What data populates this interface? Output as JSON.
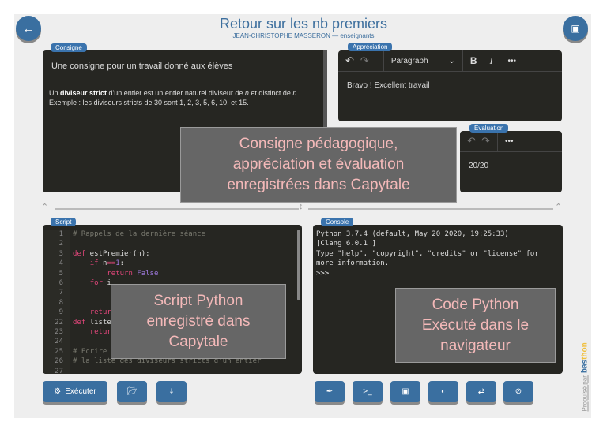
{
  "header": {
    "title": "Retour sur les nb premiers",
    "subtitle": "JEAN-CHRISTOPHE MASSERON — enseignants",
    "back_icon": "arrow-left-icon",
    "save_icon": "floppy-disk-icon"
  },
  "consigne": {
    "tag": "Consigne",
    "heading": "Une consigne pour un travail donné aux élèves",
    "p1_a": "Un ",
    "p1_bold": "diviseur strict",
    "p1_b": " d'un entier est un entier naturel diviseur de ",
    "p1_n": "n",
    "p1_c": " et distinct de ",
    "p1_n2": "n",
    "p1_d": ".",
    "p2": "Exemple : les diviseurs stricts de 30 sont 1, 2, 3, 5, 6, 10, et 15."
  },
  "appreciation": {
    "tag": "Appréciation",
    "format": "Paragraph",
    "bold": "B",
    "italic": "I",
    "more": "•••",
    "text": "Bravo ! Excellent travail"
  },
  "evaluation": {
    "tag": "Évaluation",
    "more": "•••",
    "text": "20/20"
  },
  "script": {
    "tag": "Script",
    "line_numbers": [
      "1",
      "2",
      "3",
      "4",
      "5",
      "6",
      "7",
      "8",
      "9",
      "22",
      "23",
      "24",
      "25",
      "26",
      "27"
    ]
  },
  "console": {
    "tag": "Console",
    "lines": [
      "Python 3.7.4 (default, May 20 2020, 19:25:33)",
      "[Clang 6.0.1 ]",
      "Type \"help\", \"copyright\", \"credits\" or \"license\" for",
      "more information.",
      ">>>"
    ]
  },
  "overlays": {
    "top": "Consigne pédagogique,\nappréciation et évaluation\nenregistrées dans Capytale",
    "script": "Script Python\nenregistré dans\nCapytale",
    "console": "Code Python\nExécuté dans le\nnavigateur"
  },
  "buttons": {
    "run": "Exécuter",
    "run_icon": "gears-icon",
    "open_icon": "folder-open-icon",
    "download_icon": "download-icon",
    "right_icons": [
      "brush-icon",
      "terminal-icon",
      "image-icon",
      "contrast-icon",
      "swap-icon",
      "eye-slash-icon"
    ]
  },
  "footer": {
    "powered": "Propulsé par",
    "logo": "basthon"
  },
  "colors": {
    "accent": "#3a6fa0",
    "panel": "#262622",
    "overlay_text": "#f4b9b9"
  }
}
